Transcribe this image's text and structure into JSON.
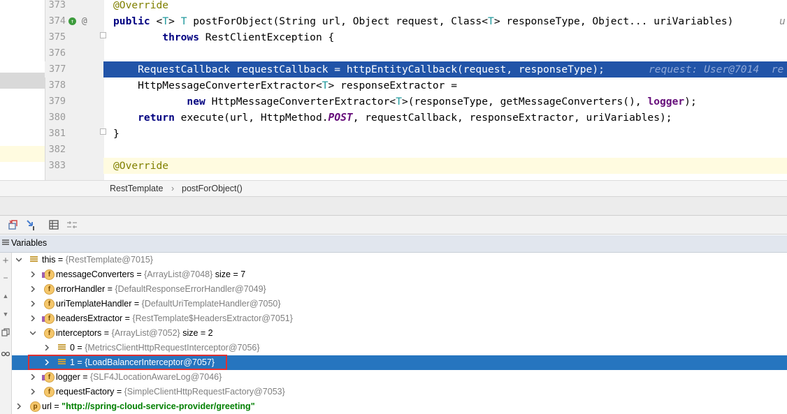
{
  "editor": {
    "lines": [
      {
        "no": "373",
        "parts": [
          {
            "t": "@Override",
            "c": "ann"
          }
        ]
      },
      {
        "no": "374",
        "parts": [
          {
            "t": "public ",
            "c": "kw"
          },
          {
            "t": "<",
            "c": ""
          },
          {
            "t": "T",
            "c": "tp"
          },
          {
            "t": "> ",
            "c": ""
          },
          {
            "t": "T",
            "c": "tp"
          },
          {
            "t": " postForObject(String url, Object request, Class<",
            "c": ""
          },
          {
            "t": "T",
            "c": "tp"
          },
          {
            "t": "> responseType, Object... uriVariables)",
            "c": ""
          }
        ],
        "gutter_icons": true,
        "hint": "u"
      },
      {
        "no": "375",
        "parts": [
          {
            "t": "        throws ",
            "c": "kw"
          },
          {
            "t": "RestClientException {",
            "c": ""
          }
        ]
      },
      {
        "no": "376",
        "parts": []
      },
      {
        "no": "377",
        "parts": [
          {
            "t": "    RequestCallback requestCallback = httpEntityCallback(request, responseType);",
            "c": ""
          }
        ],
        "highlight": true,
        "debug_hint": "request: User@7014  re"
      },
      {
        "no": "378",
        "parts": [
          {
            "t": "    HttpMessageConverterExtractor<",
            "c": ""
          },
          {
            "t": "T",
            "c": "tp"
          },
          {
            "t": "> responseExtractor =",
            "c": ""
          }
        ]
      },
      {
        "no": "379",
        "parts": [
          {
            "t": "            new ",
            "c": "kw"
          },
          {
            "t": "HttpMessageConverterExtractor<",
            "c": ""
          },
          {
            "t": "T",
            "c": "tp"
          },
          {
            "t": ">(responseType, getMessageConverters(), ",
            "c": ""
          },
          {
            "t": "logger",
            "c": "fld"
          },
          {
            "t": ");",
            "c": ""
          }
        ]
      },
      {
        "no": "380",
        "parts": [
          {
            "t": "    return ",
            "c": "kw"
          },
          {
            "t": "execute(url, HttpMethod.",
            "c": ""
          },
          {
            "t": "POST",
            "c": "cst"
          },
          {
            "t": ", requestCallback, responseExtractor, uriVariables);",
            "c": ""
          }
        ]
      },
      {
        "no": "381",
        "parts": [
          {
            "t": "}",
            "c": ""
          }
        ]
      },
      {
        "no": "382",
        "parts": []
      },
      {
        "no": "383",
        "parts": [
          {
            "t": "@Override",
            "c": "ann"
          }
        ],
        "current": true
      }
    ]
  },
  "breadcrumb": {
    "class_name": "RestTemplate",
    "separator": "›",
    "method_name": "postForObject()"
  },
  "variables": {
    "title": "Variables",
    "rows": [
      {
        "level": 0,
        "expanded": true,
        "icon": "list",
        "name": "this",
        "value": "{RestTemplate@7015}",
        "size": ""
      },
      {
        "level": 1,
        "expanded": false,
        "icon": "field-final",
        "name": "messageConverters",
        "value": "{ArrayList@7048}",
        "size": " size = 7"
      },
      {
        "level": 1,
        "expanded": false,
        "icon": "field",
        "name": "errorHandler",
        "value": "{DefaultResponseErrorHandler@7049}",
        "size": ""
      },
      {
        "level": 1,
        "expanded": false,
        "icon": "field",
        "name": "uriTemplateHandler",
        "value": "{DefaultUriTemplateHandler@7050}",
        "size": ""
      },
      {
        "level": 1,
        "expanded": false,
        "icon": "field-final",
        "name": "headersExtractor",
        "value": "{RestTemplate$HeadersExtractor@7051}",
        "size": ""
      },
      {
        "level": 1,
        "expanded": true,
        "icon": "field",
        "name": "interceptors",
        "value": "{ArrayList@7052}",
        "size": " size = 2"
      },
      {
        "level": 2,
        "expanded": false,
        "icon": "list",
        "name": "0",
        "value": "{MetricsClientHttpRequestInterceptor@7056}",
        "size": ""
      },
      {
        "level": 2,
        "expanded": false,
        "icon": "list",
        "name": "1",
        "value": "{LoadBalancerInterceptor@7057}",
        "size": "",
        "selected": true
      },
      {
        "level": 1,
        "expanded": false,
        "icon": "field-final",
        "name": "logger",
        "value": "{SLF4JLocationAwareLog@7046}",
        "size": ""
      },
      {
        "level": 1,
        "expanded": false,
        "icon": "field",
        "name": "requestFactory",
        "value": "{SimpleClientHttpRequestFactory@7053}",
        "size": ""
      },
      {
        "level": 0,
        "expanded": false,
        "icon": "param",
        "name": "url",
        "value": "\"http://spring-cloud-service-provider/greeting\"",
        "size": "",
        "string": true
      }
    ]
  },
  "colors": {
    "exec_line": "#2154a8",
    "selected_row": "#2675bf",
    "selection_box": "#e03030"
  }
}
